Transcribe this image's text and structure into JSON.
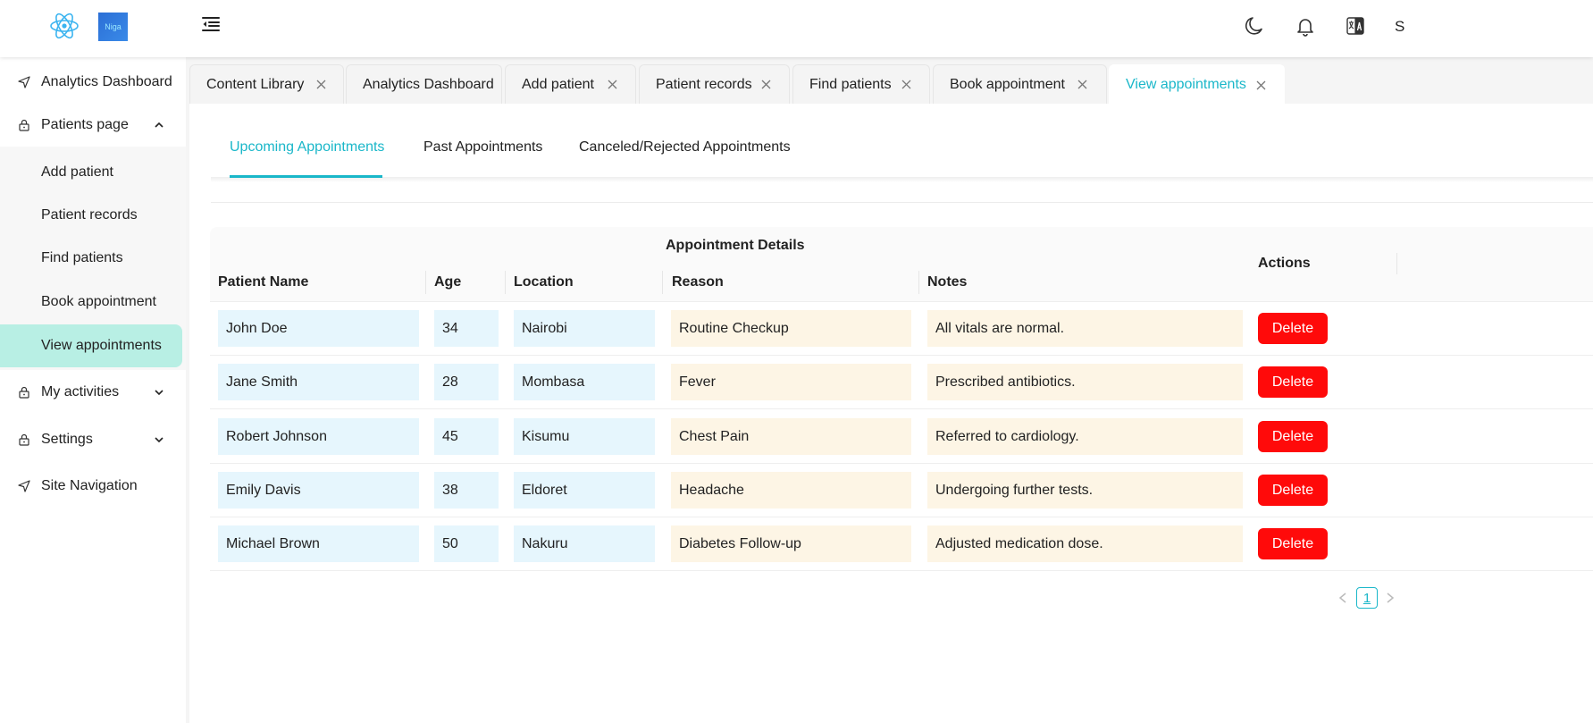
{
  "header": {
    "logo_text": "Niga",
    "user_initial": "S"
  },
  "icons": {
    "theme": "moon-icon",
    "notifications": "bell-icon",
    "language": "translate-icon",
    "menu": "menu-collapse-icon"
  },
  "sidebar": {
    "items": [
      {
        "label": "Analytics Dashboard",
        "icon": "send-icon"
      },
      {
        "label": "Patients page",
        "icon": "lock-icon",
        "expanded": true
      },
      {
        "label": "My activities",
        "icon": "lock-icon"
      },
      {
        "label": "Settings",
        "icon": "lock-icon"
      },
      {
        "label": "Site Navigation",
        "icon": "send-icon"
      }
    ],
    "sub_items": [
      "Add patient",
      "Patient records",
      "Find patients",
      "Book appointment",
      "View appointments"
    ],
    "active_sub": "View appointments"
  },
  "tabs": [
    {
      "label": "Content Library",
      "closable": true
    },
    {
      "label": "Analytics Dashboard",
      "closable": false
    },
    {
      "label": "Add patient",
      "closable": true
    },
    {
      "label": "Patient records",
      "closable": true
    },
    {
      "label": "Find patients",
      "closable": true
    },
    {
      "label": "Book appointment",
      "closable": true
    },
    {
      "label": "View appointments",
      "closable": true,
      "active": true
    }
  ],
  "subtabs": [
    "Upcoming Appointments",
    "Past Appointments",
    "Canceled/Rejected Appointments"
  ],
  "table": {
    "group_header": "Appointment Details",
    "columns": [
      "Patient Name",
      "Age",
      "Location",
      "Reason",
      "Notes",
      "Actions"
    ],
    "rows": [
      {
        "name": "John Doe",
        "age": "34",
        "location": "Nairobi",
        "reason": "Routine Checkup",
        "notes": "All vitals are normal.",
        "action": "Delete"
      },
      {
        "name": "Jane Smith",
        "age": "28",
        "location": "Mombasa",
        "reason": "Fever",
        "notes": "Prescribed antibiotics.",
        "action": "Delete"
      },
      {
        "name": "Robert Johnson",
        "age": "45",
        "location": "Kisumu",
        "reason": "Chest Pain",
        "notes": "Referred to cardiology.",
        "action": "Delete"
      },
      {
        "name": "Emily Davis",
        "age": "38",
        "location": "Eldoret",
        "reason": "Headache",
        "notes": "Undergoing further tests.",
        "action": "Delete"
      },
      {
        "name": "Michael Brown",
        "age": "50",
        "location": "Nakuru",
        "reason": "Diabetes Follow-up",
        "notes": "Adjusted medication dose.",
        "action": "Delete"
      }
    ]
  },
  "pagination": {
    "current_page": "1"
  },
  "colors": {
    "accent": "#1ab7c9",
    "active_sidebar_bg": "#b8efe4",
    "delete_button": "#ff0a0a",
    "cell_blue": "#e6f6fd",
    "cell_cream": "#fdf5e5"
  }
}
